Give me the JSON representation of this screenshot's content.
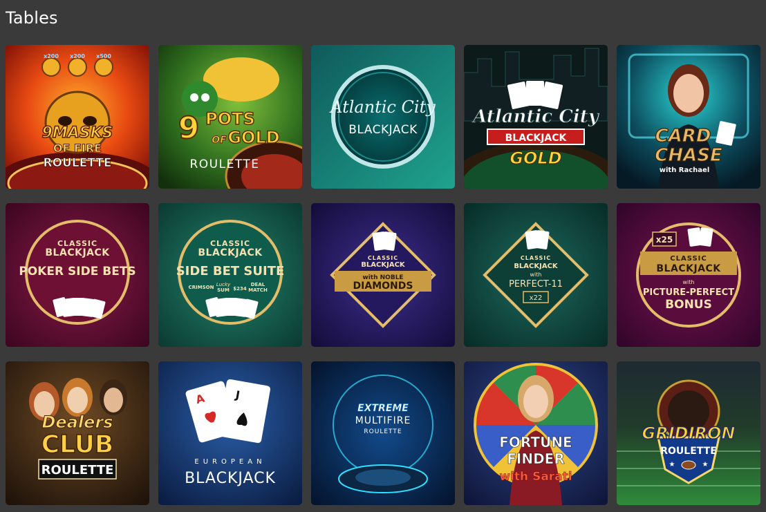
{
  "section": {
    "title": "Tables"
  },
  "games": [
    {
      "id": "9-masks",
      "lines": [
        "9MASKS",
        "OF FIRE",
        "ROULETTE"
      ],
      "badges": [
        "x200",
        "x200",
        "x500"
      ]
    },
    {
      "id": "9-pots",
      "lines": [
        "9",
        "POTS",
        "OF",
        "GOLD",
        "ROULETTE"
      ]
    },
    {
      "id": "atlantic-city",
      "lines": [
        "Atlantic City",
        "BLACKJACK"
      ]
    },
    {
      "id": "atlantic-city-gold",
      "lines": [
        "Atlantic City",
        "BLACKJACK",
        "GOLD"
      ]
    },
    {
      "id": "card-chase",
      "lines": [
        "CARD",
        "CHASE",
        "with Rachael"
      ]
    },
    {
      "id": "classic-poker-side",
      "lines": [
        "CLASSIC",
        "BLACKJACK",
        "POKER SIDE BETS"
      ]
    },
    {
      "id": "classic-side-suite",
      "lines": [
        "CLASSIC",
        "BLACKJACK",
        "SIDE BET SUITE",
        "CRIMSON",
        "Lucky",
        "SUM",
        "$234",
        "DEAL",
        "MATCH"
      ]
    },
    {
      "id": "classic-noble",
      "lines": [
        "CLASSIC",
        "BLACKJACK",
        "with NOBLE",
        "DIAMONDS"
      ]
    },
    {
      "id": "classic-perfect11",
      "lines": [
        "CLASSIC",
        "BLACKJACK",
        "with",
        "PERFECT-11",
        "x22"
      ]
    },
    {
      "id": "classic-picture",
      "lines": [
        "x25",
        "CLASSIC",
        "BLACKJACK",
        "with",
        "PICTURE-PERFECT",
        "BONUS"
      ]
    },
    {
      "id": "dealers-club",
      "lines": [
        "Dealers",
        "CLUB",
        "ROULETTE"
      ]
    },
    {
      "id": "european-bj",
      "lines": [
        "EUROPEAN",
        "BLACKJACK"
      ]
    },
    {
      "id": "extreme-multifire",
      "lines": [
        "EXTREME",
        "MULTIFIRE",
        "ROULETTE"
      ]
    },
    {
      "id": "fortune-finder",
      "lines": [
        "FORTUNE",
        "FINDER",
        "with Sarati"
      ]
    },
    {
      "id": "gridiron",
      "lines": [
        "GRIDIRON",
        "ROULETTE"
      ]
    }
  ]
}
